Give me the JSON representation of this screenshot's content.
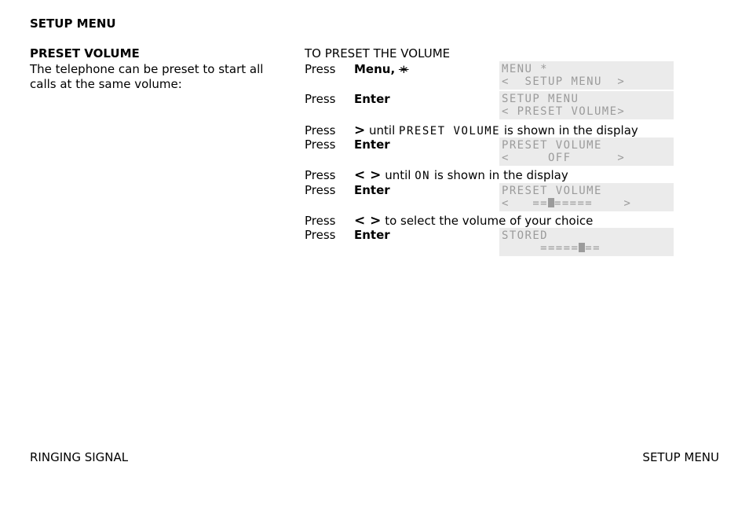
{
  "header": {
    "section_title": "SETUP MENU"
  },
  "left": {
    "subtitle": "PRESET VOLUME",
    "description": "The telephone can be preset to start all calls at the same volume:"
  },
  "procedure": {
    "title": "TO PRESET THE VOLUME",
    "steps": [
      {
        "press": "Press",
        "action": "Menu,",
        "symbol": "∗"
      },
      {
        "press": "Press",
        "action": "Enter"
      },
      {
        "press": "Press",
        "arrow": ">",
        "text_before": " until ",
        "mono": "PRESET VOLUME",
        "text_after": " is shown in the display"
      },
      {
        "press": "Press",
        "action": "Enter"
      },
      {
        "press": "Press",
        "arrow": "< >",
        "text_before": " until ",
        "mono": "ON",
        "text_after": " is shown in the display"
      },
      {
        "press": "Press",
        "action": "Enter"
      },
      {
        "press": "Press",
        "arrow": "< >",
        "text_after": " to select the volume of your choice"
      },
      {
        "press": "Press",
        "action": "Enter"
      }
    ]
  },
  "displays": [
    {
      "line1": "MENU *",
      "line2": "<  SETUP MENU  >"
    },
    {
      "line1": "SETUP MENU",
      "line2": "< PRESET VOLUME>"
    },
    {
      "line1": "PRESET VOLUME",
      "line2": "<     OFF      >"
    },
    {
      "line1": "PRESET VOLUME",
      "line2_pre": "<   ==",
      "line2_post": "=====    >",
      "volume_level": 3,
      "volume_steps": 8
    },
    {
      "line1": "STORED",
      "line2_pre": "     =====",
      "line2_post": "==",
      "volume_level": 6,
      "volume_steps": 8
    }
  ],
  "footer": {
    "left": "RINGING SIGNAL",
    "right": "SETUP MENU"
  }
}
